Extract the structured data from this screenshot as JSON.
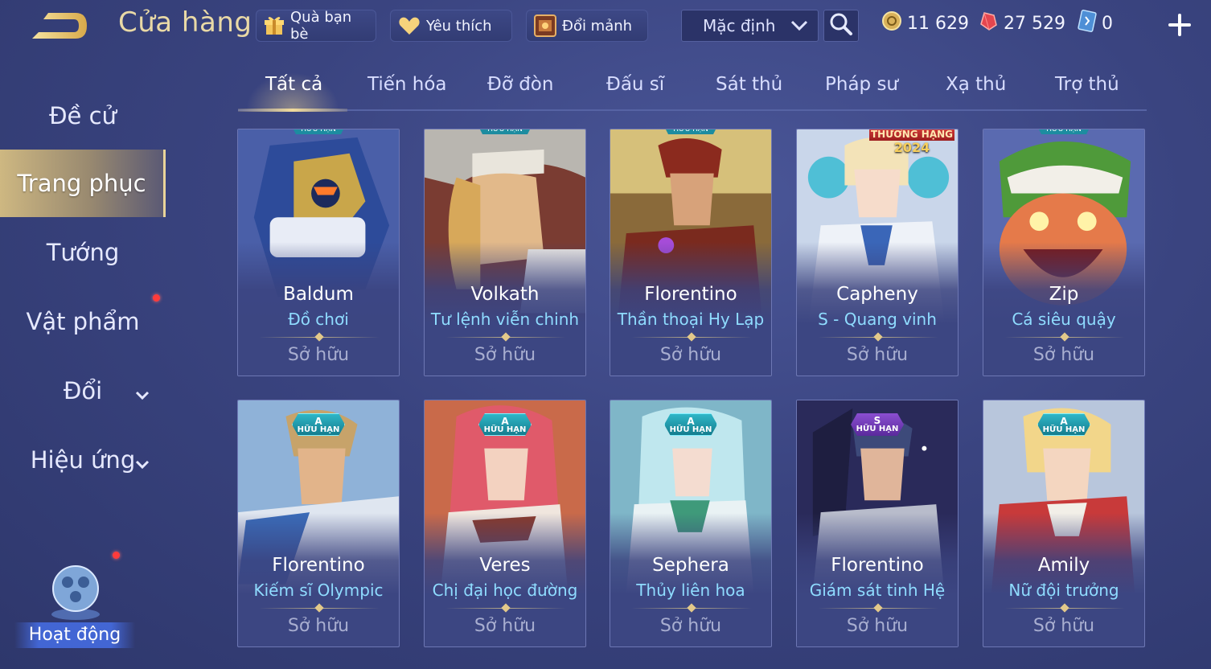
{
  "header": {
    "title": "Cửa hàng",
    "gift_label": "Quà bạn bè",
    "favorite_label": "Yêu thích",
    "trade_label": "Đổi mảnh",
    "sort_value": "Mặc định",
    "gold": "11 629",
    "vouchers": "27 529",
    "tickets": "0"
  },
  "sidebar": {
    "items": [
      {
        "label": "Đề cử"
      },
      {
        "label": "Trang phục"
      },
      {
        "label": "Tướng"
      },
      {
        "label": "Vật phẩm"
      },
      {
        "label": "Đổi"
      },
      {
        "label": "Hiệu ứng"
      }
    ],
    "activity_label": "Hoạt động"
  },
  "tabs": [
    {
      "label": "Tất cả"
    },
    {
      "label": "Tiến hóa"
    },
    {
      "label": "Đỡ đòn"
    },
    {
      "label": "Đấu sĩ"
    },
    {
      "label": "Sát thủ"
    },
    {
      "label": "Pháp sư"
    },
    {
      "label": "Xạ thủ"
    },
    {
      "label": "Trợ thủ"
    }
  ],
  "badges": {
    "limited": "HỮU HẠN",
    "grade_a": "A",
    "grade_s": "S",
    "rank_reward": "THƯỞNG HẠNG",
    "rank_year": "2024"
  },
  "cards": [
    {
      "hero": "Baldum",
      "skin": "Đồ chơi",
      "status": "Sở hữu"
    },
    {
      "hero": "Volkath",
      "skin": "Tư lệnh viễn chinh",
      "status": "Sở hữu"
    },
    {
      "hero": "Florentino",
      "skin": "Thần thoại Hy Lạp",
      "status": "Sở hữu"
    },
    {
      "hero": "Capheny",
      "skin": "S - Quang vinh",
      "status": "Sở hữu"
    },
    {
      "hero": "Zip",
      "skin": "Cá siêu quậy",
      "status": "Sở hữu"
    },
    {
      "hero": "Florentino",
      "skin": "Kiếm sĩ Olympic",
      "status": "Sở hữu"
    },
    {
      "hero": "Veres",
      "skin": "Chị đại học đường",
      "status": "Sở hữu"
    },
    {
      "hero": "Sephera",
      "skin": "Thủy liên hoa",
      "status": "Sở hữu"
    },
    {
      "hero": "Florentino",
      "skin": "Giám sát tinh Hệ",
      "status": "Sở hữu"
    },
    {
      "hero": "Amily",
      "skin": "Nữ đội trưởng",
      "status": "Sở hữu"
    }
  ],
  "colors": {
    "accent_gold": "#e9d9a6",
    "skin_name": "#8fdcff",
    "badge_a": "#1d9fb1",
    "badge_s": "#7a3fc4",
    "notification": "#ff3b3b"
  }
}
